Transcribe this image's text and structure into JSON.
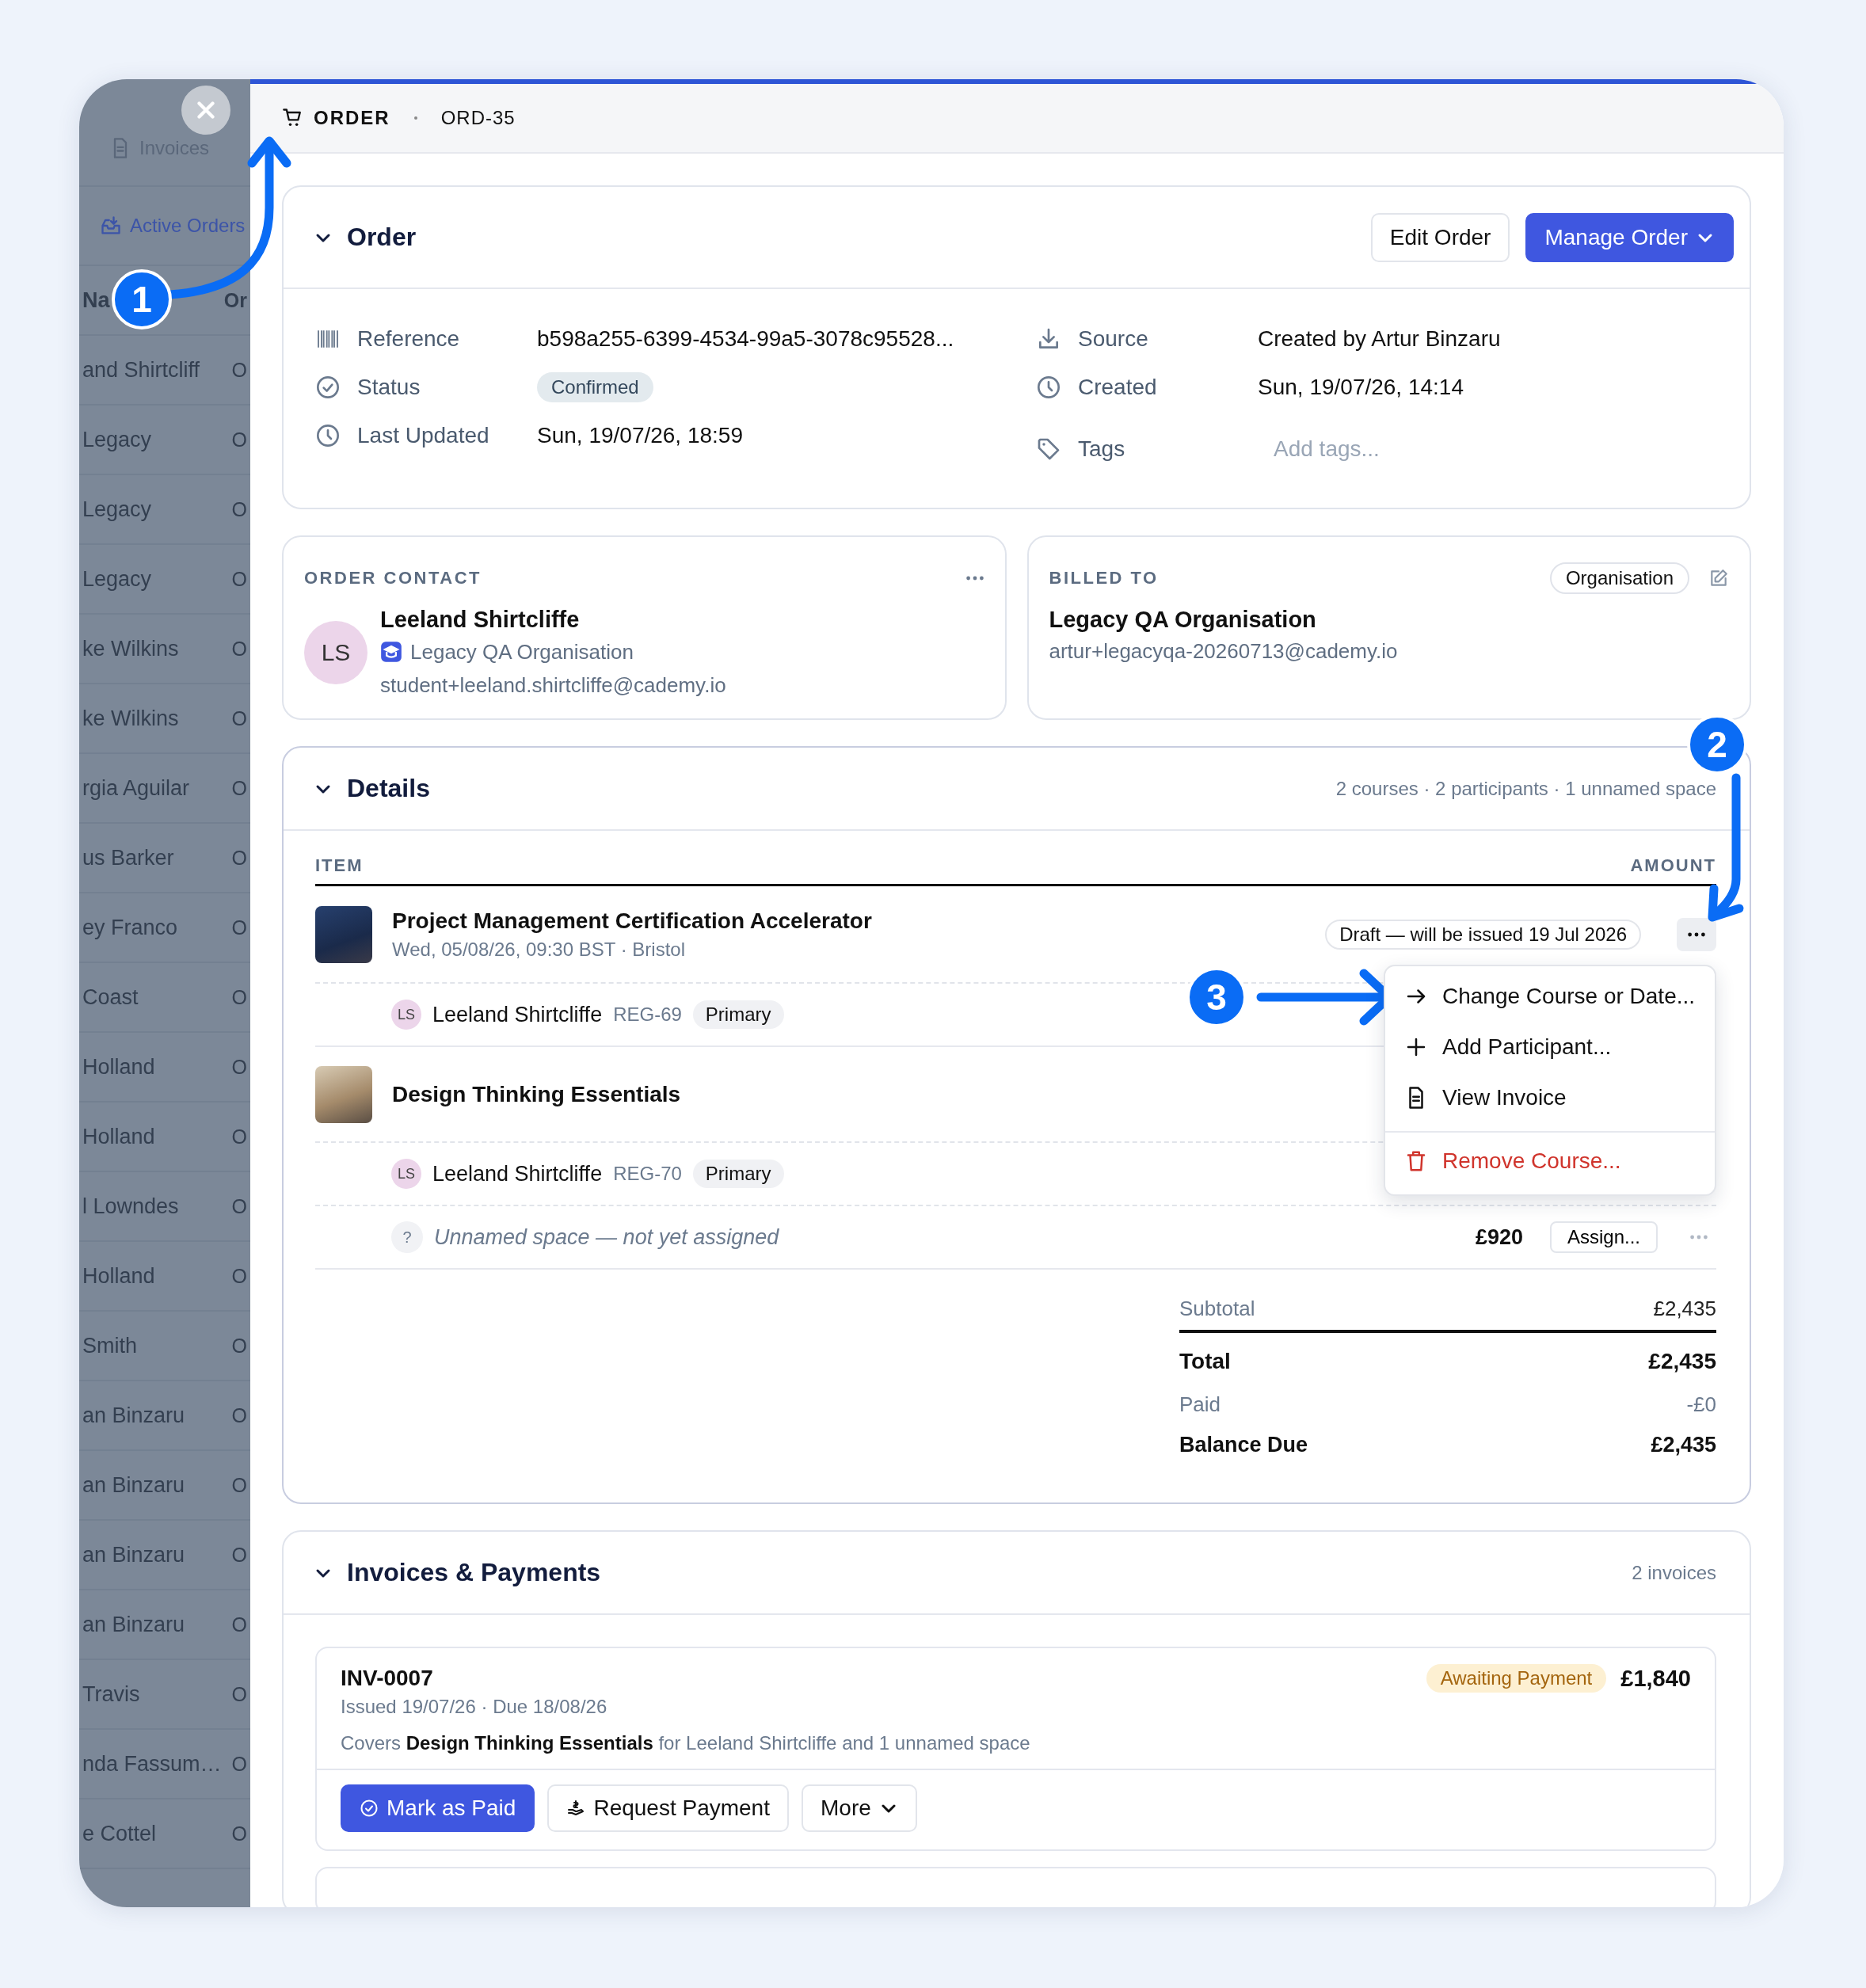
{
  "background_list": {
    "tabs": [
      {
        "label": "Invoices",
        "kind": "doc",
        "selected": false
      },
      {
        "label": "Active Orders",
        "kind": "inbox",
        "selected": true
      }
    ],
    "columns": [
      "Na",
      "Or"
    ],
    "rows": [
      {
        "name": "and Shirtcliff",
        "order": "O"
      },
      {
        "name": "Legacy",
        "order": "O"
      },
      {
        "name": "Legacy",
        "order": "O"
      },
      {
        "name": "Legacy",
        "order": "O"
      },
      {
        "name": "ke Wilkins",
        "order": "O"
      },
      {
        "name": "ke Wilkins",
        "order": "O"
      },
      {
        "name": "rgia Aguilar",
        "order": "O"
      },
      {
        "name": "us Barker",
        "order": "O"
      },
      {
        "name": "ey Franco",
        "order": "O"
      },
      {
        "name": "Coast",
        "order": "O"
      },
      {
        "name": "Holland",
        "order": "O"
      },
      {
        "name": "Holland",
        "order": "O"
      },
      {
        "name": "l Lowndes",
        "order": "O"
      },
      {
        "name": "Holland",
        "order": "O"
      },
      {
        "name": "Smith",
        "order": "O"
      },
      {
        "name": "an Binzaru",
        "order": "O"
      },
      {
        "name": "an Binzaru",
        "order": "O"
      },
      {
        "name": "an Binzaru",
        "order": "O"
      },
      {
        "name": "an Binzaru",
        "order": "O"
      },
      {
        "name": "Travis",
        "order": "O"
      },
      {
        "name": "nda Fassum…",
        "order": "O"
      },
      {
        "name": "e Cottel",
        "order": "O"
      }
    ]
  },
  "header": {
    "type": "ORDER",
    "id": "ORD-35"
  },
  "order": {
    "title": "Order",
    "expanded": true,
    "buttons": [
      {
        "label": "Edit Order",
        "kind": "secondary"
      },
      {
        "label": "Manage Order",
        "kind": "primary-menu"
      }
    ],
    "fields_left": [
      {
        "kind": "reference",
        "label": "Reference",
        "value": "b598a255-6399-4534-99a5-3078c95528..."
      },
      {
        "kind": "status",
        "label": "Status",
        "value": "Confirmed"
      },
      {
        "kind": "date",
        "label": "Last Updated",
        "value": "Sun, 19/07/26, 18:59"
      }
    ],
    "fields_right": [
      {
        "kind": "source",
        "label": "Source",
        "value": "Created by Artur Binzaru"
      },
      {
        "kind": "date",
        "label": "Created",
        "value": "Sun, 19/07/26, 14:14"
      },
      {
        "kind": "tags",
        "label": "Tags",
        "placeholder": "Add tags..."
      }
    ]
  },
  "order_contact": {
    "heading": "ORDER CONTACT",
    "initials": "LS",
    "name": "Leeland Shirtcliffe",
    "organisation": "Legacy QA Organisation",
    "email": "student+leeland.shirtcliffe@cademy.io"
  },
  "billed_to": {
    "heading": "BILLED TO",
    "type": "Organisation",
    "name": "Legacy QA Organisation",
    "email": "artur+legacyqa-20260713@cademy.io"
  },
  "details": {
    "title": "Details",
    "expanded": true,
    "summary": "2 courses · 2 participants · 1 unnamed space",
    "columns": [
      "ITEM",
      "AMOUNT"
    ],
    "items": [
      {
        "kind": "course",
        "title": "Project Management Certification Accelerator",
        "subtitle": "Wed, 05/08/26, 09:30 BST · Bristol",
        "status": "Draft — will be issued 19 Jul 2026",
        "menu_open": true
      },
      {
        "kind": "participant",
        "initials": "LS",
        "name": "Leeland Shirtcliffe",
        "reg": "REG-69",
        "role": "Primary"
      },
      {
        "kind": "course",
        "title": "Design Thinking Essentials",
        "menu_open": false
      },
      {
        "kind": "participant",
        "initials": "LS",
        "name": "Leeland Shirtcliffe",
        "reg": "REG-70",
        "role": "Primary"
      },
      {
        "kind": "unnamed",
        "mark": "?",
        "text": "Unnamed space — not yet assigned",
        "amount": "£920",
        "action": "Assign..."
      }
    ],
    "menu": [
      {
        "kind": "change",
        "label": "Change Course or Date..."
      },
      {
        "kind": "add",
        "label": "Add Participant..."
      },
      {
        "kind": "invoice",
        "label": "View Invoice"
      },
      {
        "kind": "danger",
        "label": "Remove Course..."
      }
    ],
    "totals": [
      {
        "kind": "subtotal",
        "label": "Subtotal",
        "value": "£2,435"
      },
      {
        "kind": "total",
        "label": "Total",
        "value": "£2,435"
      },
      {
        "kind": "paid",
        "label": "Paid",
        "value": "-£0"
      },
      {
        "kind": "balance",
        "label": "Balance Due",
        "value": "£2,435"
      }
    ]
  },
  "invoices": {
    "title": "Invoices & Payments",
    "expanded": true,
    "summary": "2 invoices",
    "items": [
      {
        "number": "INV-0007",
        "status": "Awaiting Payment",
        "amount": "£1,840",
        "dates": "Issued 19/07/26 · Due 18/08/26",
        "description": "Covers **Design Thinking Essentials** for Leeland Shirtcliffe and 1 unnamed space",
        "actions": [
          {
            "label": "Mark as Paid",
            "kind": "primary"
          },
          {
            "label": "Request Payment",
            "kind": "request"
          },
          {
            "label": "More",
            "kind": "dropdown"
          }
        ]
      }
    ]
  },
  "callouts": [
    {
      "number": "1"
    },
    {
      "number": "2"
    },
    {
      "number": "3"
    }
  ]
}
